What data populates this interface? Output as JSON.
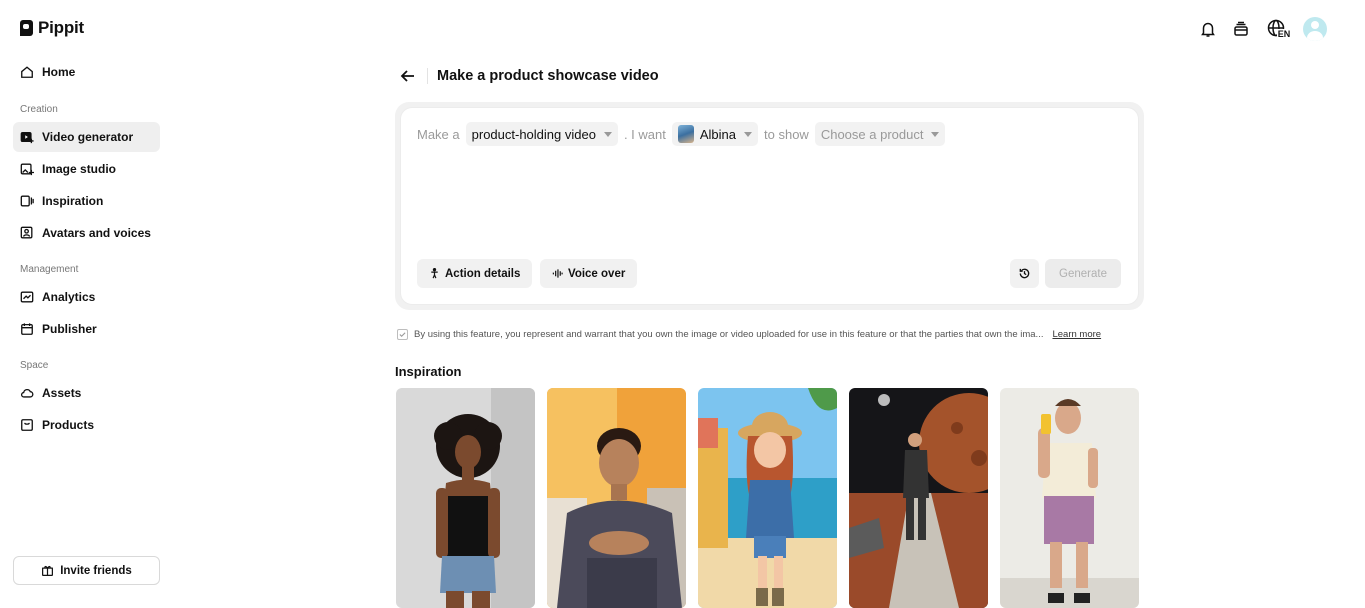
{
  "app": {
    "name": "Pippit"
  },
  "sidebar": {
    "top_item": {
      "label": "Home"
    },
    "sections": [
      {
        "label": "Creation",
        "items": [
          "Video generator",
          "Image studio",
          "Inspiration",
          "Avatars and voices"
        ]
      },
      {
        "label": "Management",
        "items": [
          "Analytics",
          "Publisher"
        ]
      },
      {
        "label": "Space",
        "items": [
          "Assets",
          "Products"
        ]
      }
    ],
    "active_item": "Video generator",
    "invite_label": "Invite friends"
  },
  "header": {
    "language": "EN"
  },
  "main": {
    "title": "Make a product showcase video",
    "prompt": {
      "prefix": "Make a",
      "video_type": "product-holding video",
      "middle": ". I want",
      "avatar_name": "Albina",
      "suffix": "to show",
      "product_placeholder": "Choose a product"
    },
    "buttons": {
      "action_details": "Action details",
      "voice_over": "Voice over",
      "generate": "Generate"
    },
    "consent_text": "By using this feature, you represent and warrant that you own the image or video uploaded for use in this feature or that the parties that own the ima...",
    "learn_more": "Learn more",
    "inspiration_title": "Inspiration"
  },
  "colors": {
    "active_bg": "#efefef",
    "chip_bg": "#f2f2f2",
    "disabled_text": "#b0b0b0"
  }
}
